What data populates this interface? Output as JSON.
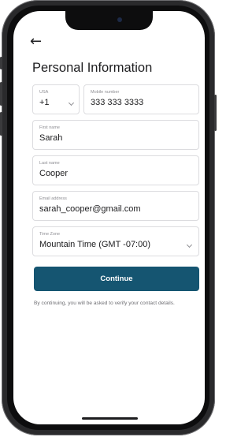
{
  "screen": {
    "title": "Personal Information",
    "back_icon": "←"
  },
  "phone": {
    "country_label": "USA",
    "country_code": "+1",
    "mobile_label": "Mobile number",
    "mobile_value": "333 333 3333"
  },
  "first_name": {
    "label": "First name",
    "value": "Sarah"
  },
  "last_name": {
    "label": "Last name",
    "value": "Cooper"
  },
  "email": {
    "label": "Email address",
    "value": "sarah_cooper@gmail.com"
  },
  "timezone": {
    "label": "Time Zone",
    "value": "Mountain Time (GMT -07:00)"
  },
  "continue_label": "Continue",
  "note": "By continuing, you will be asked to verify your contact details.",
  "colors": {
    "primary": "#155571",
    "text": "#1d1d1f",
    "muted": "#8e8e93"
  },
  "icons": [
    "back-arrow-icon",
    "chevron-down-icon"
  ]
}
